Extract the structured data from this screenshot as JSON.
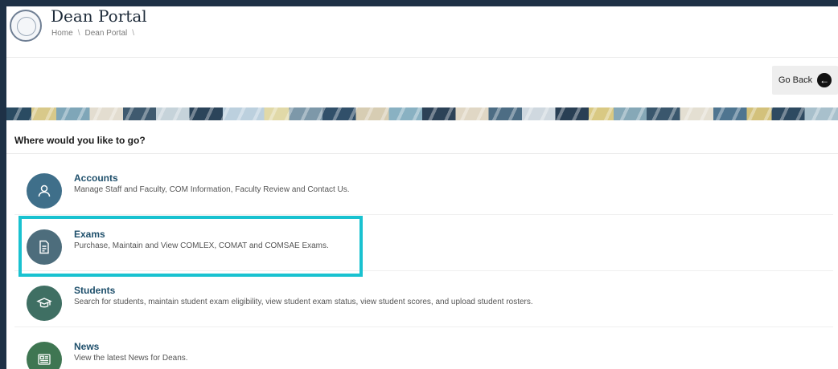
{
  "header": {
    "title": "Dean Portal",
    "breadcrumb": [
      "Home",
      "Dean Portal"
    ],
    "separator": "\\"
  },
  "go_back": {
    "label": "Go Back",
    "icon": "arrow-left-circle-icon"
  },
  "section": {
    "heading": "Where would you like to go?"
  },
  "items": [
    {
      "name": "Accounts",
      "description": "Manage Staff and Faculty, COM Information, Faculty Review and Contact Us.",
      "icon": "user-icon",
      "color": "#3f6f8a"
    },
    {
      "name": "Exams",
      "description": "Purchase, Maintain and View COMLEX, COMAT and COMSAE Exams.",
      "icon": "document-icon",
      "color": "#4d6d7c"
    },
    {
      "name": "Students",
      "description": "Search for students, maintain student exam eligibility, view student exam status, view student scores, and upload student rosters.",
      "icon": "graduation-cap-icon",
      "color": "#3f6f63"
    },
    {
      "name": "News",
      "description": "View the latest News for Deans.",
      "icon": "newspaper-icon",
      "color": "#3f7652"
    }
  ],
  "colors": {
    "highlight": "#19c2d0",
    "frame": "#1e3146"
  }
}
